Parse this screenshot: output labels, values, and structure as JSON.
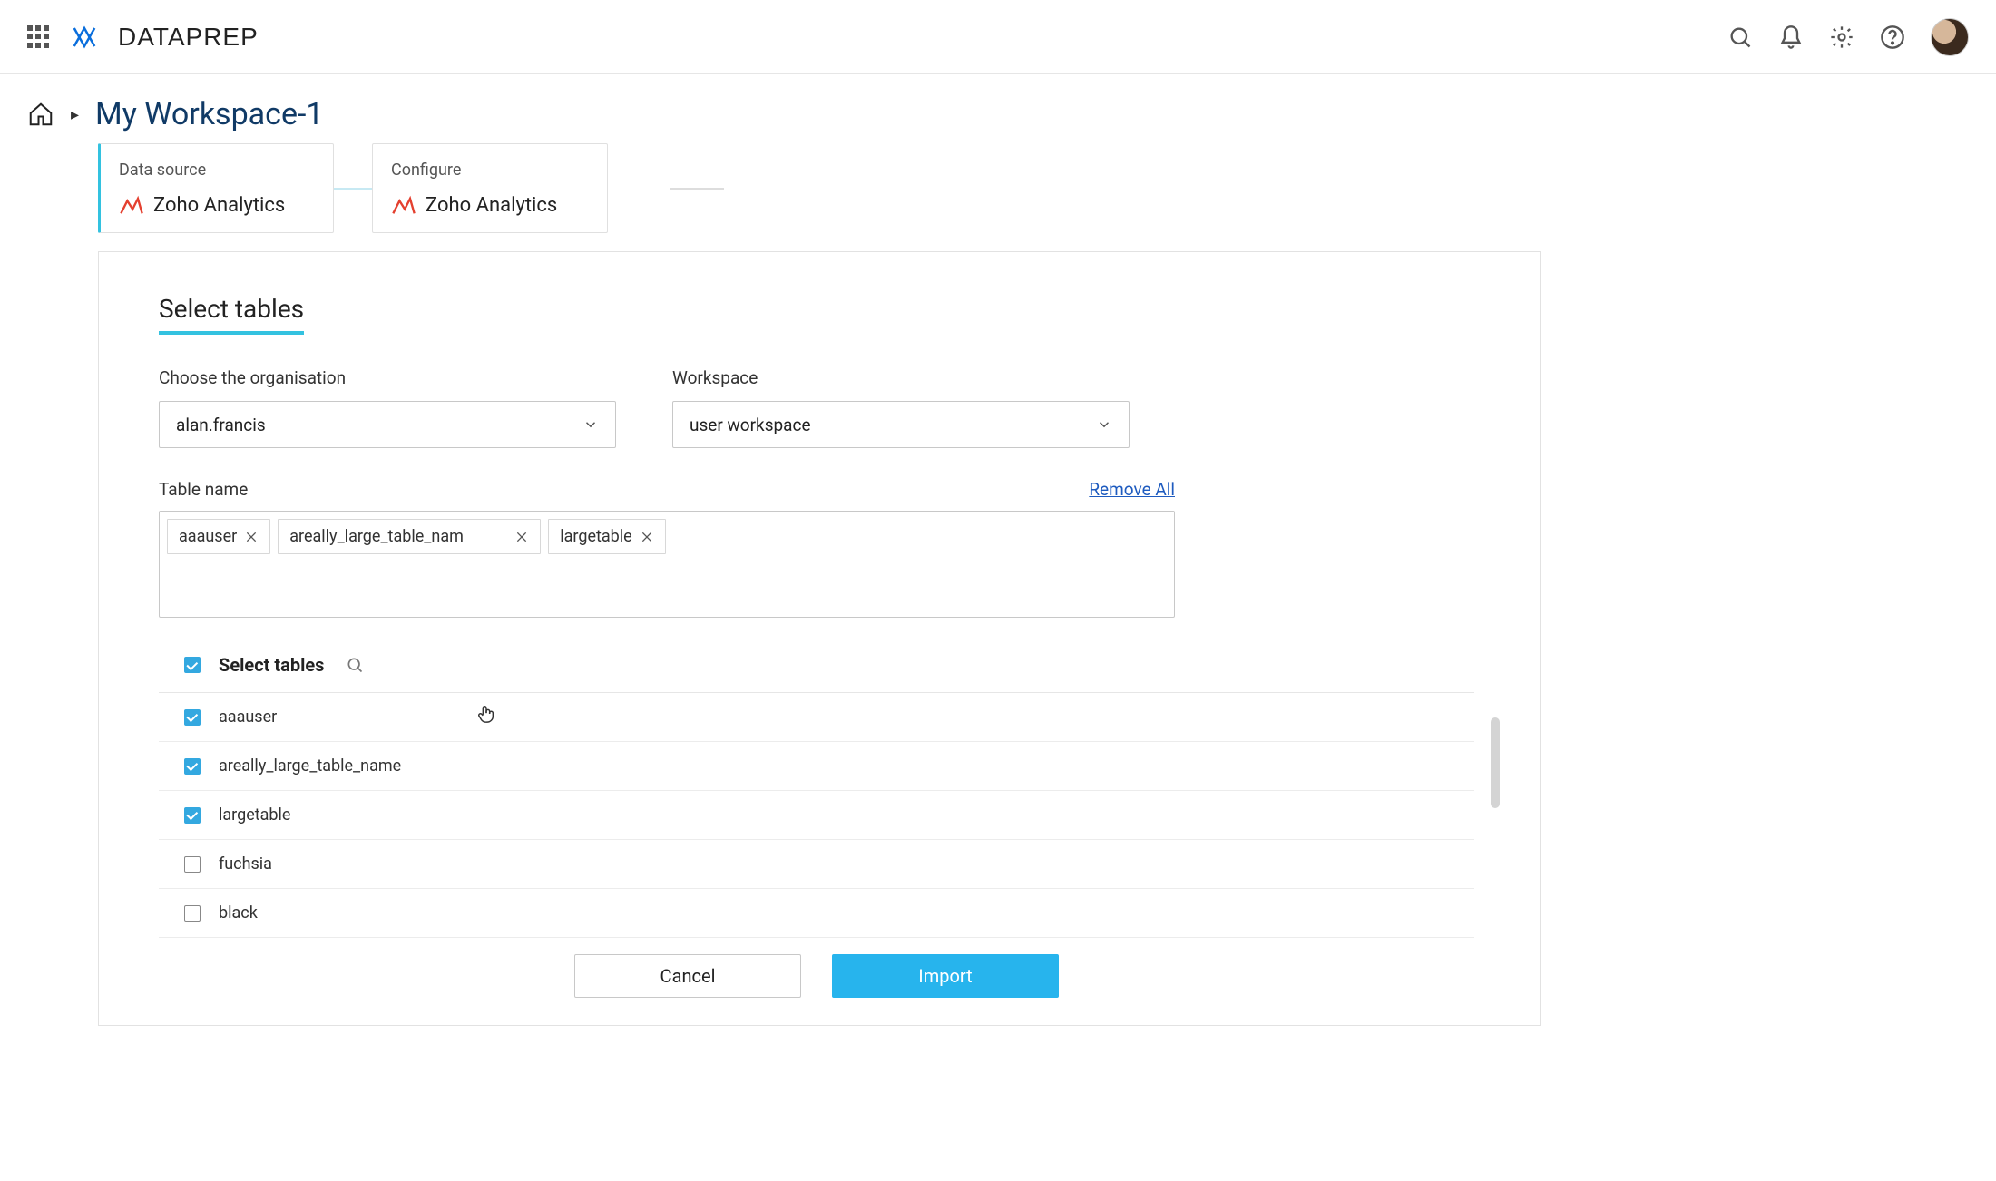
{
  "header": {
    "brand": "DATAPREP"
  },
  "breadcrumb": {
    "title": "My Workspace-1"
  },
  "steps": [
    {
      "title": "Data source",
      "name": "Zoho Analytics"
    },
    {
      "title": "Configure",
      "name": "Zoho Analytics"
    }
  ],
  "panel": {
    "title": "Select tables",
    "org_label": "Choose the organisation",
    "org_value": "alan.francis",
    "ws_label": "Workspace",
    "ws_value": "user workspace",
    "table_name_label": "Table name",
    "remove_all": "Remove All",
    "tags": [
      "aaauser",
      "areally_large_table_nam",
      "largetable"
    ],
    "list_header": "Select tables",
    "rows": [
      {
        "name": "aaauser",
        "checked": true
      },
      {
        "name": "areally_large_table_name",
        "checked": true
      },
      {
        "name": "largetable",
        "checked": true
      },
      {
        "name": "fuchsia",
        "checked": false
      },
      {
        "name": "black",
        "checked": false
      }
    ],
    "cancel": "Cancel",
    "import": "Import"
  }
}
